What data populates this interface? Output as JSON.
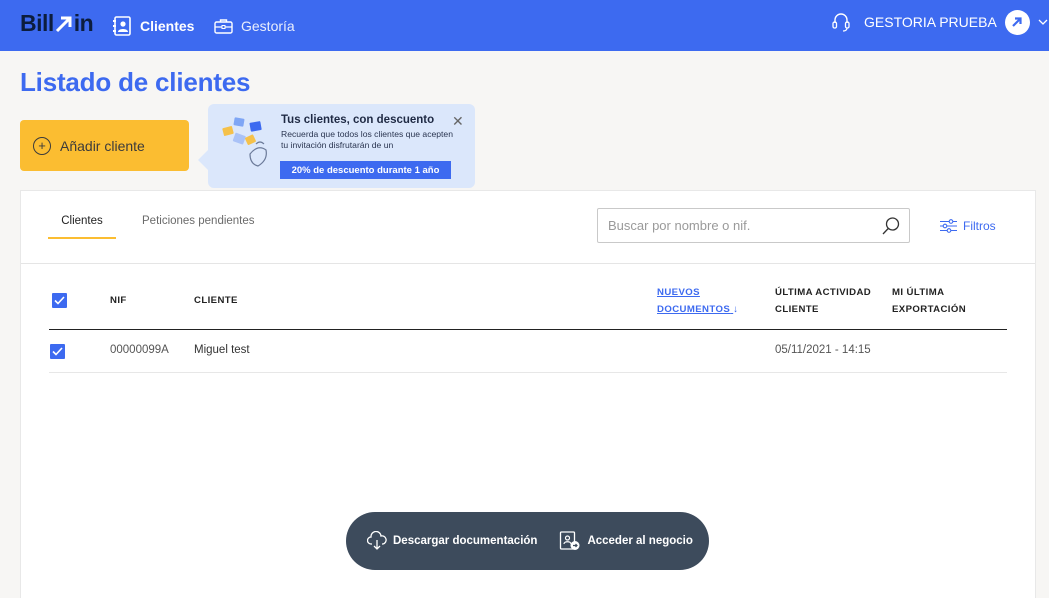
{
  "header": {
    "logo_text": "Bill in",
    "logo_left": "Bill",
    "logo_right": "in",
    "nav": [
      {
        "label": "Clientes",
        "icon": "contact-card-icon",
        "active": true
      },
      {
        "label": "Gestoría",
        "icon": "briefcase-icon",
        "active": false
      }
    ],
    "support_icon": "headset-icon",
    "account_name": "GESTORIA PRUEBA",
    "avatar_icon": "arrow-up-right-icon"
  },
  "page": {
    "title": "Listado de clientes",
    "add_button_label": "Añadir cliente"
  },
  "promo": {
    "title": "Tus clientes, con descuento",
    "text": "Recuerda que todos los clientes que acepten tu invitación disfrutarán de un",
    "badge": "20% de descuento durante 1 año"
  },
  "tabs": [
    {
      "label": "Clientes",
      "active": true
    },
    {
      "label": "Peticiones pendientes",
      "active": false
    }
  ],
  "search": {
    "placeholder": "Buscar por nombre o nif."
  },
  "filters_label": "Filtros",
  "table": {
    "columns": {
      "nif": "NIF",
      "cliente": "CLIENTE",
      "nuevos_1": "NUEVOS",
      "nuevos_2": "DOCUMENTOS",
      "nuevos_sort": "↓",
      "actividad_1": "ÚLTIMA ACTIVIDAD",
      "actividad_2": "CLIENTE",
      "export_1": "MI ÚLTIMA",
      "export_2": "EXPORTACIÓN"
    },
    "rows": [
      {
        "selected": true,
        "nif": "00000099A",
        "cliente": "Miguel test",
        "nuevos": "",
        "actividad": "05/11/2021 - 14:15",
        "export": ""
      }
    ]
  },
  "actions": {
    "download": "Descargar documentación",
    "access": "Acceder al negocio"
  },
  "colors": {
    "brand_blue": "#3d6af0",
    "accent_yellow": "#fbbd31",
    "action_bar": "#3d4b5c",
    "promo_bg": "#dbe7fb"
  }
}
